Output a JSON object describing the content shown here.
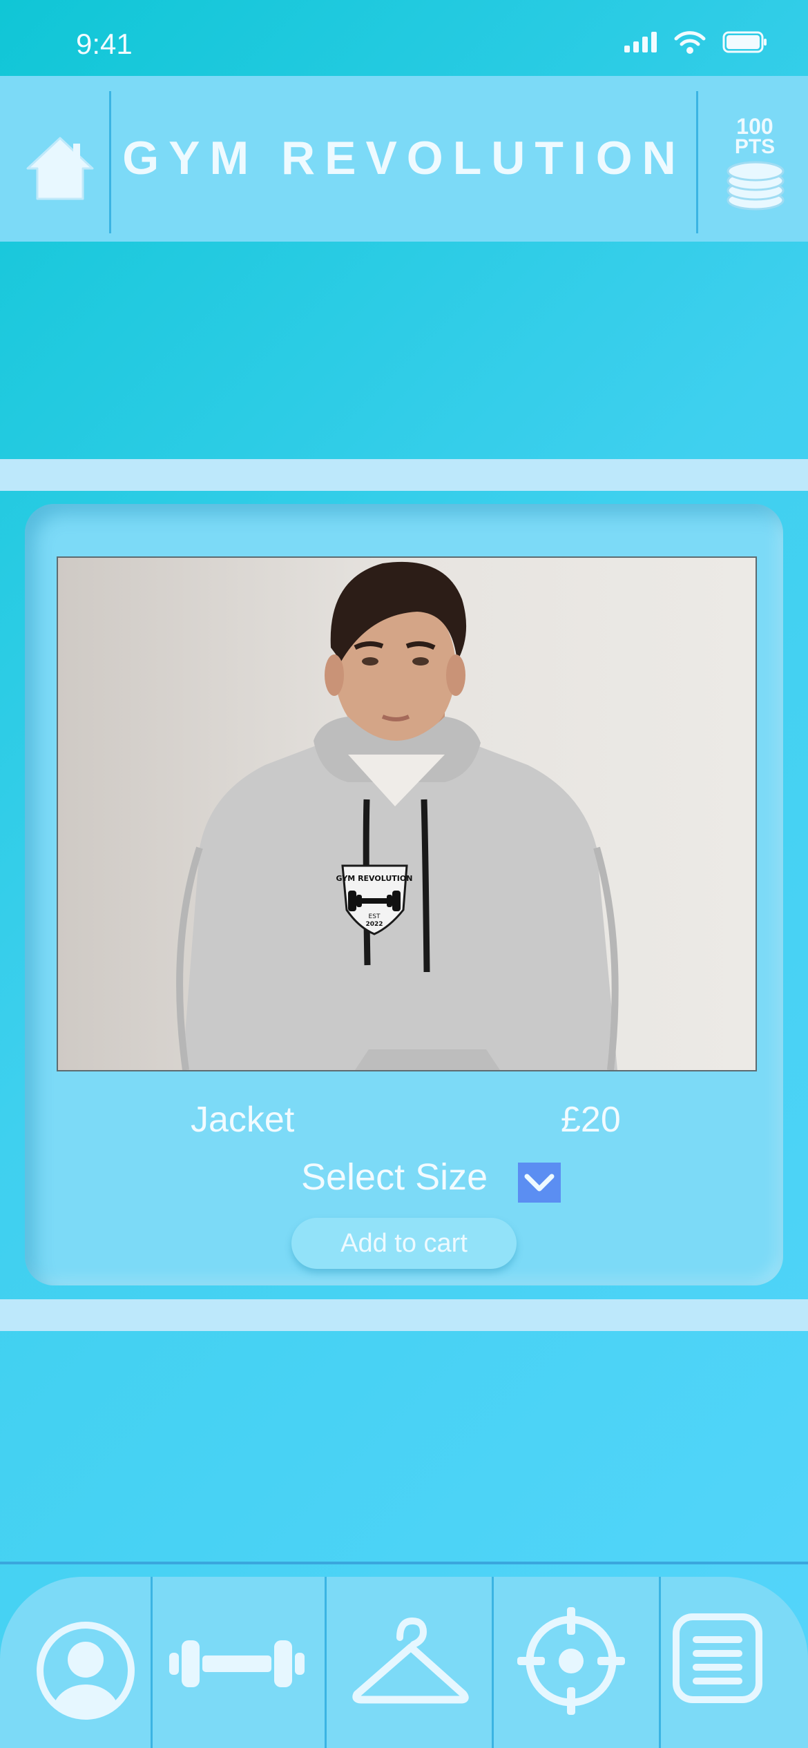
{
  "status_bar": {
    "time": "9:41"
  },
  "header": {
    "title": "GYM REVOLUTION",
    "points_value": "100",
    "points_unit": "PTS"
  },
  "product": {
    "name": "Jacket",
    "price": "£20",
    "size_label": "Select Size",
    "add_to_cart_label": "Add to cart",
    "image_print_line1": "GYM REVOLUTION",
    "image_print_est": "EST",
    "image_print_year": "2022"
  },
  "bottom_nav": [
    "profile-icon",
    "dumbbell-icon",
    "hanger-icon",
    "target-icon",
    "menu-list-icon"
  ],
  "colors": {
    "background": "#3fd0ef",
    "header": "#7cdaf7",
    "band": "#bde8fb",
    "dropdown": "#5b8ef2",
    "icon": "#e6f7ff"
  }
}
